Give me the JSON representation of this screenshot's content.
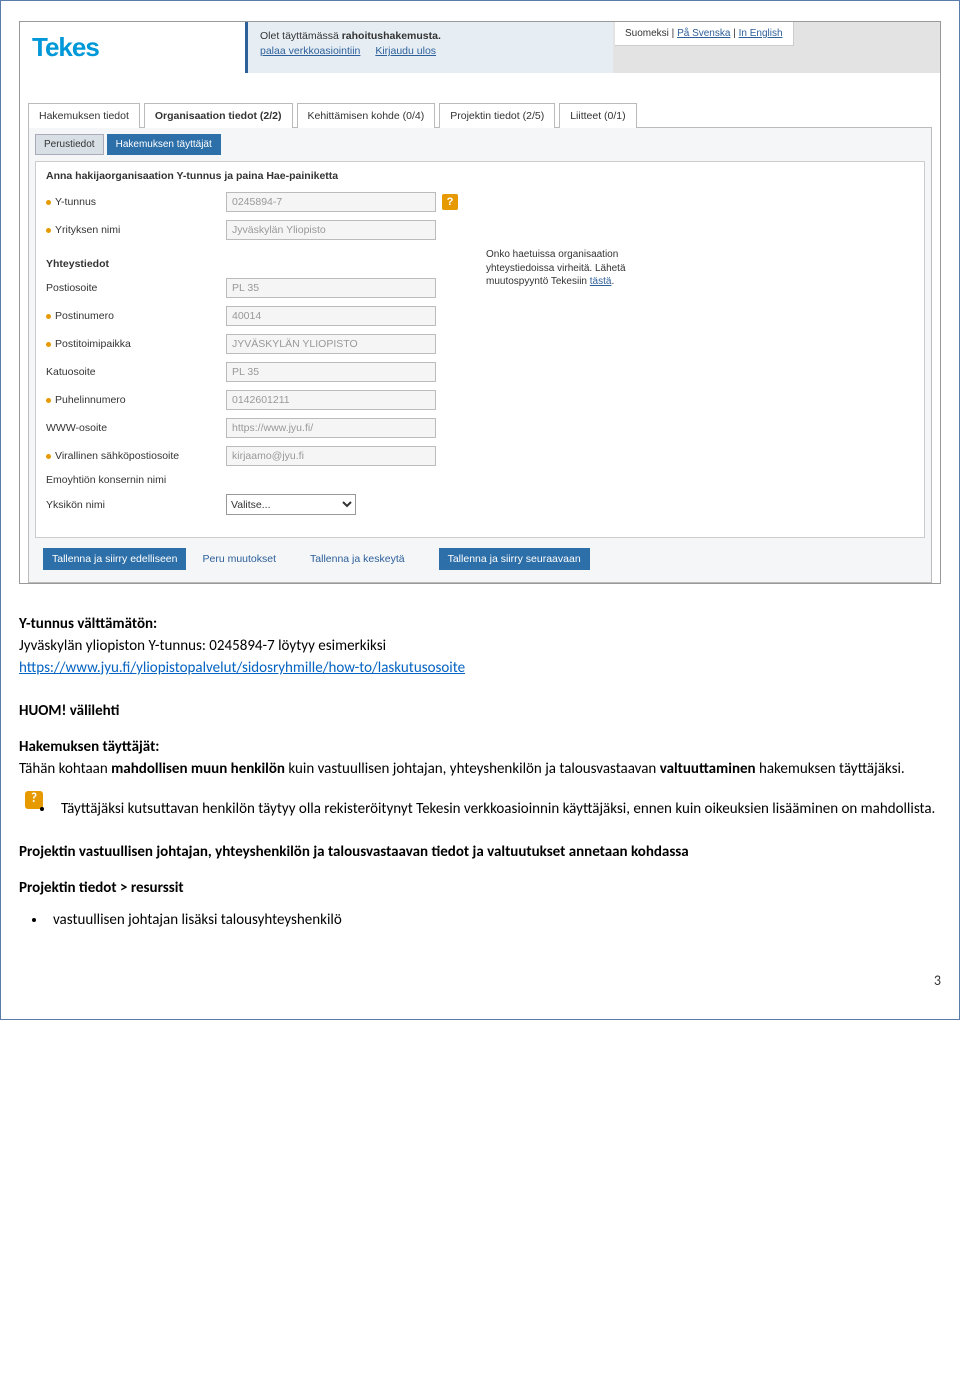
{
  "header": {
    "logo": "Tekes",
    "notice_pre": "Olet täyttämässä ",
    "notice_bold": "rahoitushakemusta.",
    "link_back": "palaa verkkoasiointiin",
    "link_logout": "Kirjaudu ulos",
    "lang_fi": "Suomeksi",
    "lang_sv": "På Svenska",
    "lang_en": "In English"
  },
  "tabs1": {
    "t0": "Hakemuksen tiedot",
    "t1": "Organisaation tiedot (2/2)",
    "t2": "Kehittämisen kohde (0/4)",
    "t3": "Projektin tiedot (2/5)",
    "t4": "Liitteet (0/1)"
  },
  "tabs2": {
    "t0": "Perustiedot",
    "t1": "Hakemuksen täyttäjät"
  },
  "form": {
    "heading": "Anna hakijaorganisaation Y-tunnus ja paina Hae-painiketta",
    "ytunnus_label": "Y-tunnus",
    "ytunnus_value": "0245894-7",
    "yritys_label": "Yrityksen nimi",
    "yritys_value": "Jyväskylän Yliopisto",
    "sec_yhteys": "Yhteystiedot",
    "posti_label": "Postiosoite",
    "posti_value": "PL 35",
    "postinro_label": "Postinumero",
    "postinro_value": "40014",
    "postitp_label": "Postitoimipaikka",
    "postitp_value": "JYVÄSKYLÄN YLIOPISTO",
    "katu_label": "Katuosoite",
    "katu_value": "PL 35",
    "puh_label": "Puhelinnumero",
    "puh_value": "0142601211",
    "www_label": "WWW-osoite",
    "www_value": "https://www.jyu.fi/",
    "email_label": "Virallinen sähköpostiosoite",
    "email_value": "kirjaamo@jyu.fi",
    "emo_label": "Emoyhtiön konsernin nimi",
    "yksikko_label": "Yksikön nimi",
    "yksikko_value": "Valitse...",
    "note_pre": "Onko haetuissa organisaation yhteystiedoissa virheitä. Lähetä muutospyyntö Tekesiin ",
    "note_link": "tästä",
    "note_post": "."
  },
  "buttons": {
    "prev": "Tallenna ja siirry edelliseen",
    "cancel": "Peru muutokset",
    "savepause": "Tallenna ja keskeytä",
    "next": "Tallenna ja siirry seuraavaan"
  },
  "doc": {
    "t1": "Y-tunnus välttämätön:",
    "t2_pre": "Jyväskylän yliopiston Y-tunnus: 0245894-7 löytyy esimerkiksi",
    "t2_link": "https://www.jyu.fi/yliopistopalvelut/sidosryhmille/how-to/laskutusosoite",
    "huom": "HUOM! välilehti",
    "t3": "Hakemuksen täyttäjät:",
    "t4_pre": "Tähän kohtaan ",
    "t4_b1": "mahdollisen muun henkilön",
    "t4_mid": " kuin vastuullisen johtajan, yhteyshenkilön ja talousvastaavan ",
    "t4_b2": "valtuuttaminen",
    "t4_post": " hakemuksen täyttäjäksi.",
    "bul1": "Täyttäjäksi kutsuttavan henkilön täytyy olla rekisteröitynyt Tekesin verkkoasioinnin käyttäjäksi, ennen kuin oikeuksien lisääminen on mahdollista.",
    "t5": "Projektin vastuullisen johtajan, yhteyshenkilön ja talousvastaavan tiedot ja valtuutukset annetaan kohdassa",
    "t6": "Projektin tiedot > resurssit",
    "bul2": "vastuullisen johtajan lisäksi talousyhteyshenkilö",
    "pagenum": "3"
  }
}
